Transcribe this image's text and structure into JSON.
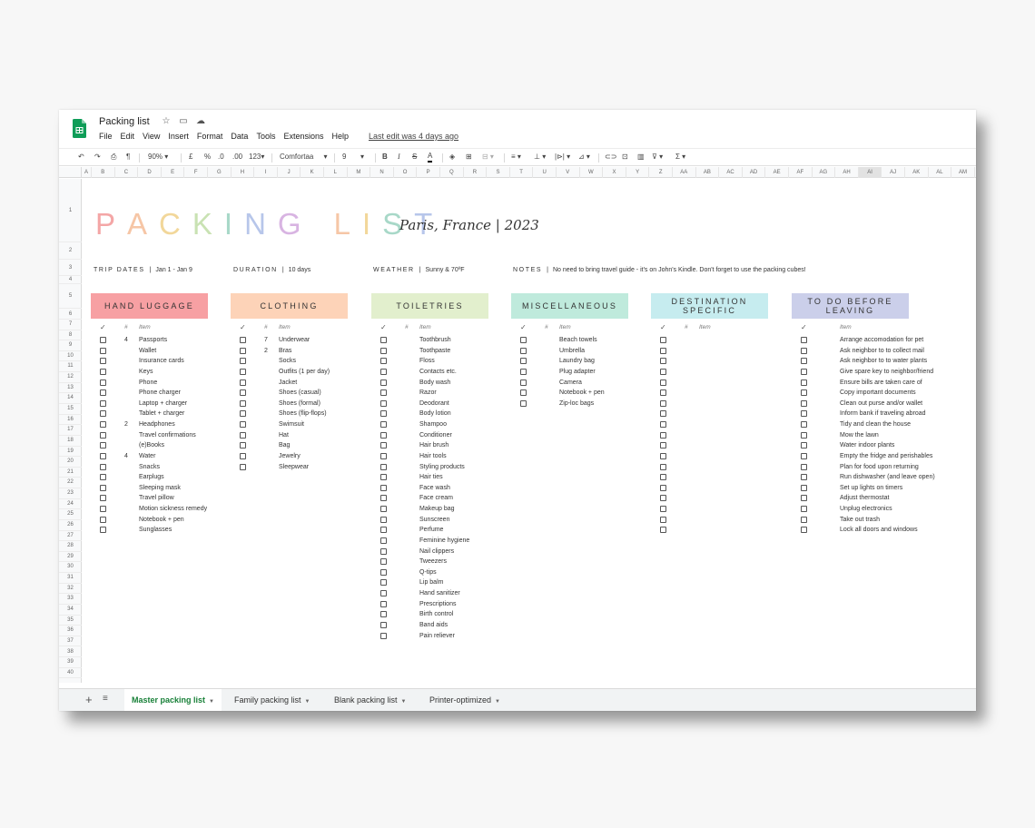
{
  "app": {
    "doc_title": "Packing list",
    "menu": [
      "File",
      "Edit",
      "View",
      "Insert",
      "Format",
      "Data",
      "Tools",
      "Extensions",
      "Help"
    ],
    "last_edit": "Last edit was 4 days ago"
  },
  "toolbar": {
    "zoom": "90%",
    "currency": "£",
    "percent": "%",
    "dec_decrease": ".0",
    "dec_increase": ".00",
    "format_more": "123",
    "font": "Comfortaa",
    "font_size": "9",
    "bold": "B",
    "italic": "I",
    "strike": "S",
    "text_color": "A",
    "functions": "Σ"
  },
  "grid": {
    "columns": [
      "A",
      "B",
      "C",
      "D",
      "E",
      "F",
      "G",
      "H",
      "I",
      "J",
      "K",
      "L",
      "M",
      "N",
      "O",
      "P",
      "Q",
      "R",
      "S",
      "T",
      "U",
      "V",
      "W",
      "X",
      "Y",
      "Z",
      "AA",
      "AB",
      "AC",
      "AD",
      "AE",
      "AF",
      "AG",
      "AH",
      "AI",
      "AJ",
      "AK",
      "AL",
      "AM"
    ],
    "selected_column": "AI",
    "rows": [
      "1",
      "2",
      "3",
      "4",
      "5",
      "6",
      "7",
      "8",
      "9",
      "10",
      "11",
      "12",
      "13",
      "14",
      "15",
      "16",
      "17",
      "18",
      "19",
      "20",
      "21",
      "22",
      "23",
      "24",
      "25",
      "26",
      "27",
      "28",
      "29",
      "30",
      "31",
      "32",
      "33",
      "34",
      "35",
      "36",
      "37",
      "38",
      "39",
      "40"
    ]
  },
  "sheet": {
    "title_letters": [
      "P",
      "A",
      "C",
      "K",
      "I",
      "N",
      "G",
      " ",
      "L",
      "I",
      "S",
      "T"
    ],
    "title_colors": [
      "#f4a6a6",
      "#f6c6a6",
      "#f2d79a",
      "#c9e2b3",
      "#a8d8c8",
      "#b7c6ea",
      "#d8b4e2",
      "#ffffff",
      "#f6c6a6",
      "#f2d79a",
      "#a8d8c8",
      "#b7c6ea"
    ],
    "subtitle": "Paris, France  |  2023",
    "info": [
      {
        "label": "TRIP DATES",
        "value": "Jan 1 - Jan 9"
      },
      {
        "label": "DURATION",
        "value": "10 days"
      },
      {
        "label": "WEATHER",
        "value": "Sunny & 70ºF"
      },
      {
        "label": "NOTES",
        "value": "No need to bring travel guide - it's on John's Kindle. Don't forget to use the packing cubes!"
      }
    ],
    "check_symbol": "✓",
    "num_label": "#",
    "item_label": "Item",
    "categories": [
      {
        "name": "HAND LUGGAGE",
        "color": "#f7a0a3",
        "has_num": true,
        "items": [
          {
            "n": "4",
            "t": "Passports"
          },
          {
            "n": "",
            "t": "Wallet"
          },
          {
            "n": "",
            "t": "Insurance cards"
          },
          {
            "n": "",
            "t": "Keys"
          },
          {
            "n": "",
            "t": "Phone"
          },
          {
            "n": "",
            "t": "Phone charger"
          },
          {
            "n": "",
            "t": "Laptop + charger"
          },
          {
            "n": "",
            "t": "Tablet + charger"
          },
          {
            "n": "2",
            "t": "Headphones"
          },
          {
            "n": "",
            "t": "Travel confirmations"
          },
          {
            "n": "",
            "t": "(e)Books"
          },
          {
            "n": "4",
            "t": "Water"
          },
          {
            "n": "",
            "t": "Snacks"
          },
          {
            "n": "",
            "t": "Earplugs"
          },
          {
            "n": "",
            "t": "Sleeping mask"
          },
          {
            "n": "",
            "t": "Travel pillow"
          },
          {
            "n": "",
            "t": "Motion sickness remedy"
          },
          {
            "n": "",
            "t": "Notebook + pen"
          },
          {
            "n": "",
            "t": "Sunglasses"
          }
        ]
      },
      {
        "name": "CLOTHING",
        "color": "#fdd3b8",
        "has_num": true,
        "items": [
          {
            "n": "7",
            "t": "Underwear"
          },
          {
            "n": "2",
            "t": "Bras"
          },
          {
            "n": "",
            "t": "Socks"
          },
          {
            "n": "",
            "t": "Outfits (1 per day)"
          },
          {
            "n": "",
            "t": "Jacket"
          },
          {
            "n": "",
            "t": "Shoes (casual)"
          },
          {
            "n": "",
            "t": "Shoes (formal)"
          },
          {
            "n": "",
            "t": "Shoes (flip-flops)"
          },
          {
            "n": "",
            "t": "Swimsuit"
          },
          {
            "n": "",
            "t": "Hat"
          },
          {
            "n": "",
            "t": "Bag"
          },
          {
            "n": "",
            "t": "Jewelry"
          },
          {
            "n": "",
            "t": "Sleepwear"
          }
        ]
      },
      {
        "name": "TOILETRIES",
        "color": "#e2efcd",
        "has_num": true,
        "items": [
          {
            "n": "",
            "t": "Toothbrush"
          },
          {
            "n": "",
            "t": "Toothpaste"
          },
          {
            "n": "",
            "t": "Floss"
          },
          {
            "n": "",
            "t": "Contacts etc."
          },
          {
            "n": "",
            "t": "Body wash"
          },
          {
            "n": "",
            "t": "Razor"
          },
          {
            "n": "",
            "t": "Deodorant"
          },
          {
            "n": "",
            "t": "Body lotion"
          },
          {
            "n": "",
            "t": "Shampoo"
          },
          {
            "n": "",
            "t": "Conditioner"
          },
          {
            "n": "",
            "t": "Hair brush"
          },
          {
            "n": "",
            "t": "Hair tools"
          },
          {
            "n": "",
            "t": "Styling products"
          },
          {
            "n": "",
            "t": "Hair ties"
          },
          {
            "n": "",
            "t": "Face wash"
          },
          {
            "n": "",
            "t": "Face cream"
          },
          {
            "n": "",
            "t": "Makeup bag"
          },
          {
            "n": "",
            "t": "Sunscreen"
          },
          {
            "n": "",
            "t": "Perfume"
          },
          {
            "n": "",
            "t": "Feminine hygiene"
          },
          {
            "n": "",
            "t": "Nail clippers"
          },
          {
            "n": "",
            "t": "Tweezers"
          },
          {
            "n": "",
            "t": "Q-tips"
          },
          {
            "n": "",
            "t": "Lip balm"
          },
          {
            "n": "",
            "t": "Hand sanitizer"
          },
          {
            "n": "",
            "t": "Prescriptions"
          },
          {
            "n": "",
            "t": "Birth control"
          },
          {
            "n": "",
            "t": "Band aids"
          },
          {
            "n": "",
            "t": "Pain reliever"
          }
        ]
      },
      {
        "name": "MISCELLANEOUS",
        "color": "#bfeadc",
        "has_num": true,
        "items": [
          {
            "n": "",
            "t": "Beach towels"
          },
          {
            "n": "",
            "t": "Umbrella"
          },
          {
            "n": "",
            "t": "Laundry bag"
          },
          {
            "n": "",
            "t": "Plug adapter"
          },
          {
            "n": "",
            "t": "Camera"
          },
          {
            "n": "",
            "t": "Notebook + pen"
          },
          {
            "n": "",
            "t": "Zip-loc bags"
          }
        ]
      },
      {
        "name": "DESTINATION SPECIFIC",
        "color": "#c6ecef",
        "has_num": true,
        "items": [
          {
            "n": "",
            "t": ""
          },
          {
            "n": "",
            "t": ""
          },
          {
            "n": "",
            "t": ""
          },
          {
            "n": "",
            "t": ""
          },
          {
            "n": "",
            "t": ""
          },
          {
            "n": "",
            "t": ""
          },
          {
            "n": "",
            "t": ""
          },
          {
            "n": "",
            "t": ""
          },
          {
            "n": "",
            "t": ""
          },
          {
            "n": "",
            "t": ""
          },
          {
            "n": "",
            "t": ""
          },
          {
            "n": "",
            "t": ""
          },
          {
            "n": "",
            "t": ""
          },
          {
            "n": "",
            "t": ""
          },
          {
            "n": "",
            "t": ""
          },
          {
            "n": "",
            "t": ""
          },
          {
            "n": "",
            "t": ""
          },
          {
            "n": "",
            "t": ""
          },
          {
            "n": "",
            "t": ""
          }
        ]
      },
      {
        "name": "TO DO BEFORE LEAVING",
        "color": "#cbcfea",
        "has_num": false,
        "items": [
          {
            "n": "",
            "t": "Arrange accomodation for pet"
          },
          {
            "n": "",
            "t": "Ask neighbor to to collect mail"
          },
          {
            "n": "",
            "t": "Ask neighbor to to water plants"
          },
          {
            "n": "",
            "t": "Give spare key to neighbor/friend"
          },
          {
            "n": "",
            "t": "Ensure bills are taken care of"
          },
          {
            "n": "",
            "t": "Copy important documents"
          },
          {
            "n": "",
            "t": "Clean out purse and/or wallet"
          },
          {
            "n": "",
            "t": "Inform bank if traveling abroad"
          },
          {
            "n": "",
            "t": "Tidy and clean the house"
          },
          {
            "n": "",
            "t": "Mow the lawn"
          },
          {
            "n": "",
            "t": "Water indoor plants"
          },
          {
            "n": "",
            "t": "Empty the fridge and perishables"
          },
          {
            "n": "",
            "t": "Plan for food upon returning"
          },
          {
            "n": "",
            "t": "Run dishwasher (and leave open)"
          },
          {
            "n": "",
            "t": "Set up lights on timers"
          },
          {
            "n": "",
            "t": "Adjust thermostat"
          },
          {
            "n": "",
            "t": "Unplug electronics"
          },
          {
            "n": "",
            "t": "Take out trash"
          },
          {
            "n": "",
            "t": "Lock all doors and windows"
          }
        ]
      }
    ]
  },
  "tabs": [
    {
      "label": "Master packing list",
      "active": true
    },
    {
      "label": "Family packing list",
      "active": false
    },
    {
      "label": "Blank packing list",
      "active": false
    },
    {
      "label": "Printer-optimized",
      "active": false
    }
  ],
  "colors": {
    "accent_green": "#188038",
    "sheets_logo": "#0f9d58"
  }
}
